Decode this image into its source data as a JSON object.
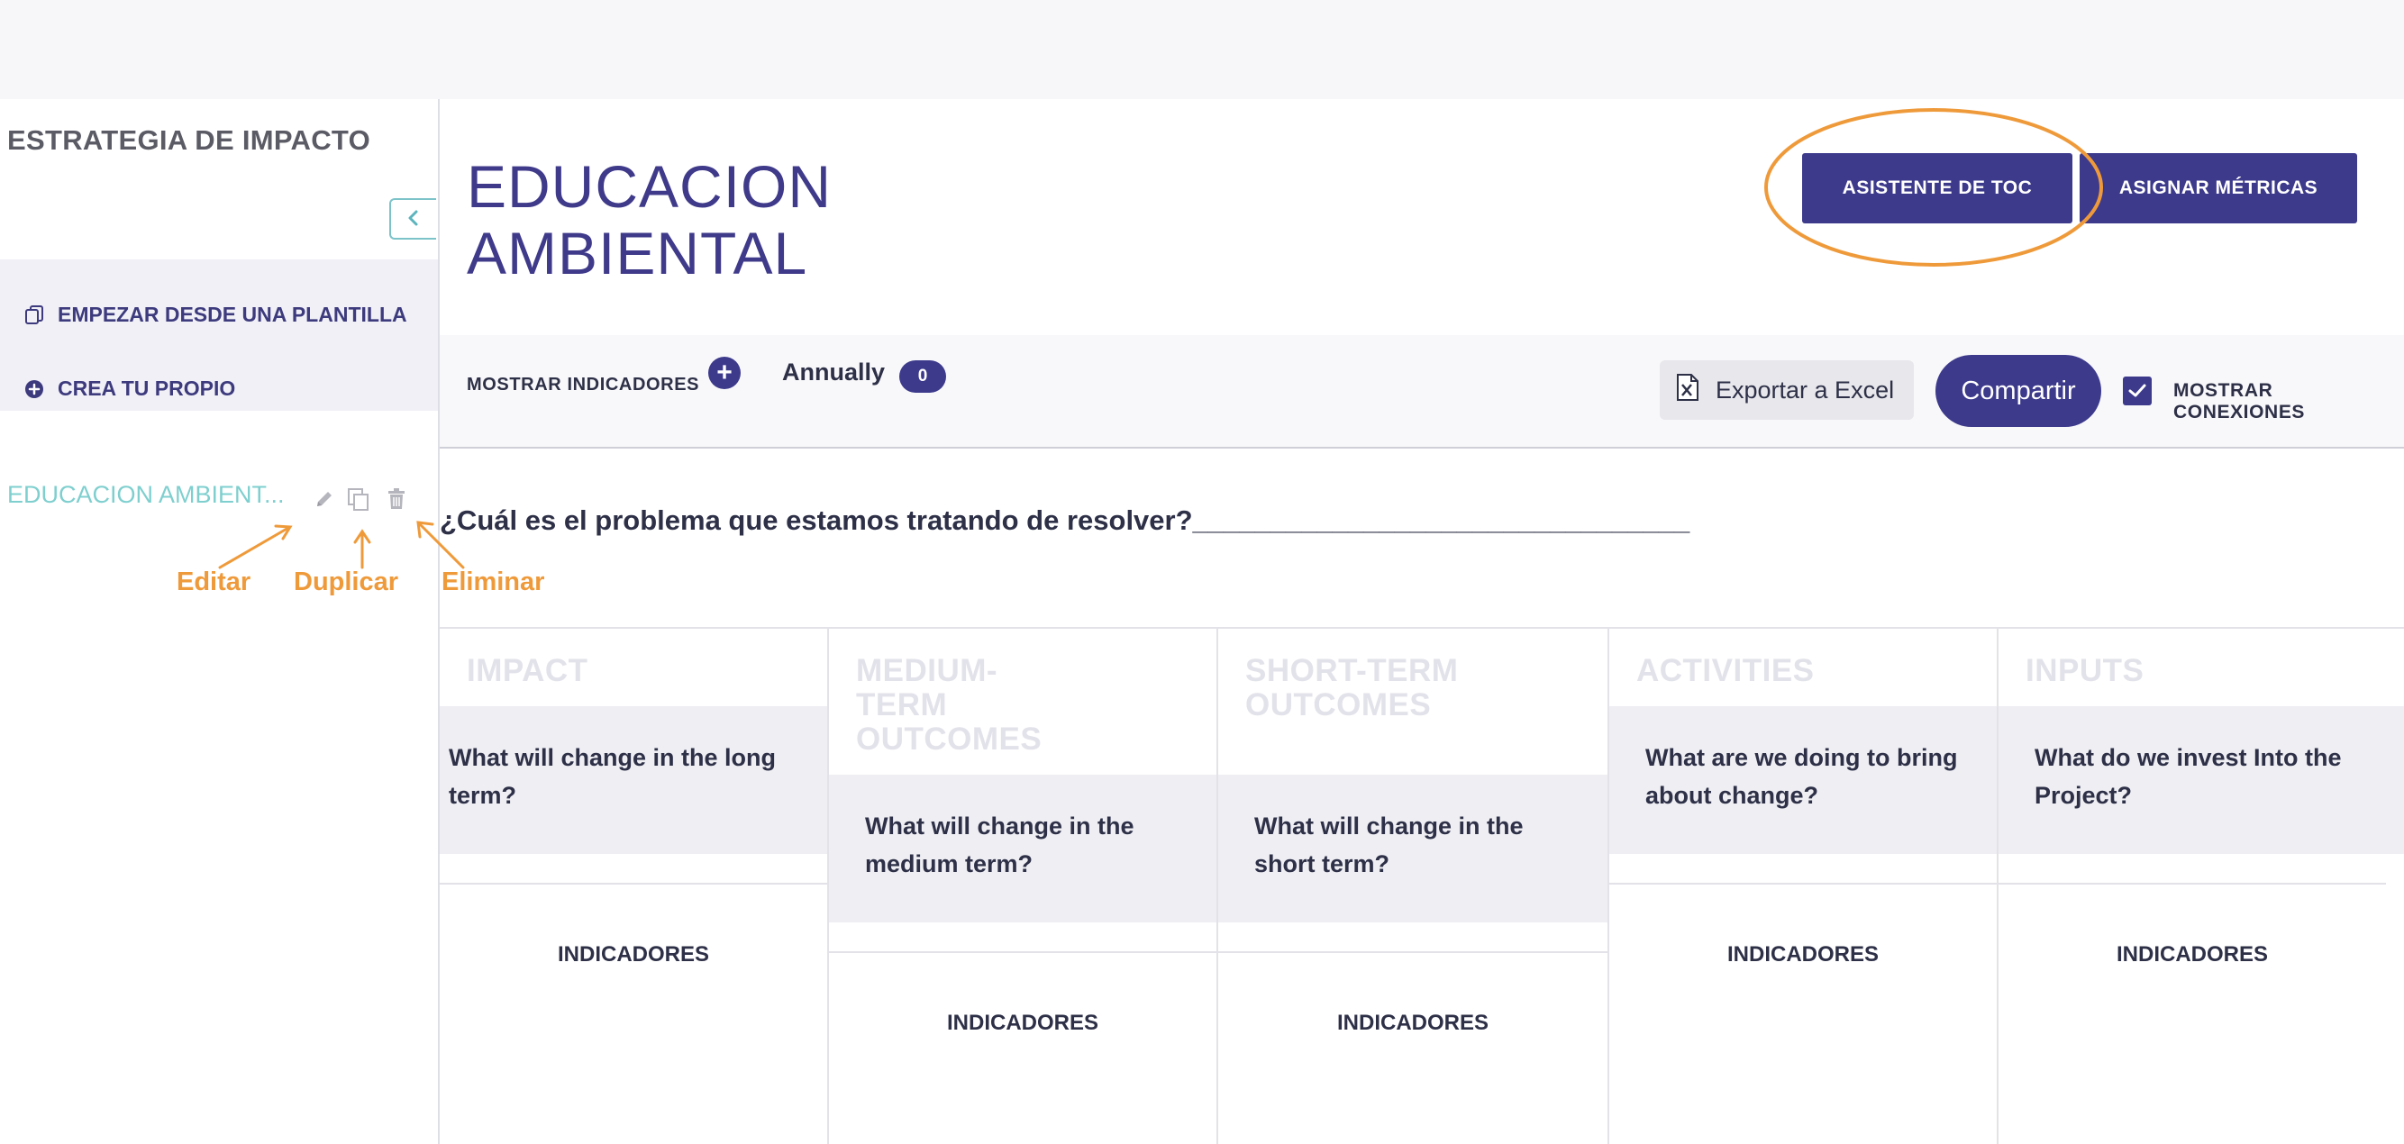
{
  "sidebar": {
    "title": "ESTRATEGIA DE IMPACTO",
    "collapse_icon": "chevron-left-icon",
    "actions": [
      {
        "label": "EMPEZAR DESDE UNA PLANTILLA",
        "icon": "template-copy-icon"
      },
      {
        "label": "CREA TU PROPIO",
        "icon": "plus-circle-icon"
      }
    ],
    "project": {
      "name": "EDUCACION AMBIENT...",
      "icons": [
        "pencil-icon",
        "duplicate-icon",
        "trash-icon"
      ]
    },
    "annotations": {
      "edit": "Editar",
      "duplicate": "Duplicar",
      "delete": "Eliminar"
    }
  },
  "header": {
    "title_line1": "EDUCACION",
    "title_line2": "AMBIENTAL",
    "toc_button": "ASISTENTE DE TOC",
    "metrics_button": "ASIGNAR MÉTRICAS"
  },
  "toolbar": {
    "show_indicators": "MOSTRAR INDICADORES",
    "frequency": "Annually",
    "frequency_count": "0",
    "export": "Exportar a Excel",
    "share": "Compartir",
    "show_connections": "MOSTRAR CONEXIONES",
    "show_connections_checked": true
  },
  "question": "¿Cuál es el problema que estamos tratando de resolver?________________________________",
  "columns": [
    {
      "title": "IMPACT",
      "question": "What will change in the long term?",
      "indicators": "INDICADORES"
    },
    {
      "title": "MEDIUM-TERM OUTCOMES",
      "question": "What will change in the medium term?",
      "indicators": "INDICADORES"
    },
    {
      "title": "SHORT-TERM OUTCOMES",
      "question": "What will change in the short term?",
      "indicators": "INDICADORES"
    },
    {
      "title": "ACTIVITIES",
      "question": "What are we doing to bring about change?",
      "indicators": "INDICADORES"
    },
    {
      "title": "INPUTS",
      "question": "What do we invest Into the Project?",
      "indicators": "INDICADORES"
    }
  ],
  "colors": {
    "primary": "#3d3a8c",
    "teal": "#7fcfcf",
    "annotation": "#ef9a3a"
  }
}
